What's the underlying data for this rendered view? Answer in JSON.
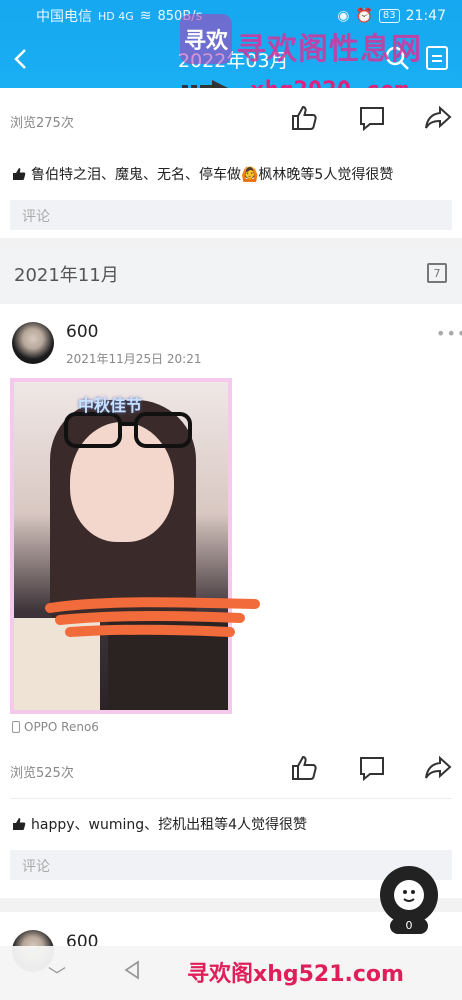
{
  "status": {
    "carrier": "中国电信",
    "network": "HD 4G",
    "speed": "850B/s",
    "battery": "83",
    "time": "21:47"
  },
  "header": {
    "title": "2022年03月"
  },
  "watermark": {
    "logo": "寻欢",
    "site_top": "寻欢阁性息网",
    "site_mid": "xhg2020.com",
    "site_bottom": "寻欢阁xhg521.com"
  },
  "post1": {
    "views": "浏览275次",
    "likes_text": "鲁伯特之泪、魔鬼、无名、停车做🙆枫林晚等5人觉得很赞",
    "comment_placeholder": "评论"
  },
  "month": {
    "label": "2021年11月",
    "calendar_day": "7"
  },
  "post2": {
    "username": "600",
    "timestamp": "2021年11月25日 20:21",
    "more": "•••",
    "photo_caption": "中秋佳节",
    "device": "OPPO Reno6",
    "views": "浏览525次",
    "likes_text": "happy、wuming、挖机出租等4人觉得很赞",
    "comment_placeholder": "评论"
  },
  "post3": {
    "username": "600"
  },
  "fab": {
    "count": "0"
  },
  "icons": {
    "back": "back-arrow-icon",
    "search": "search-icon",
    "document": "document-icon",
    "like": "thumbs-up-icon",
    "comment": "comment-icon",
    "share": "share-icon",
    "calendar": "calendar-icon",
    "device": "phone-icon"
  }
}
